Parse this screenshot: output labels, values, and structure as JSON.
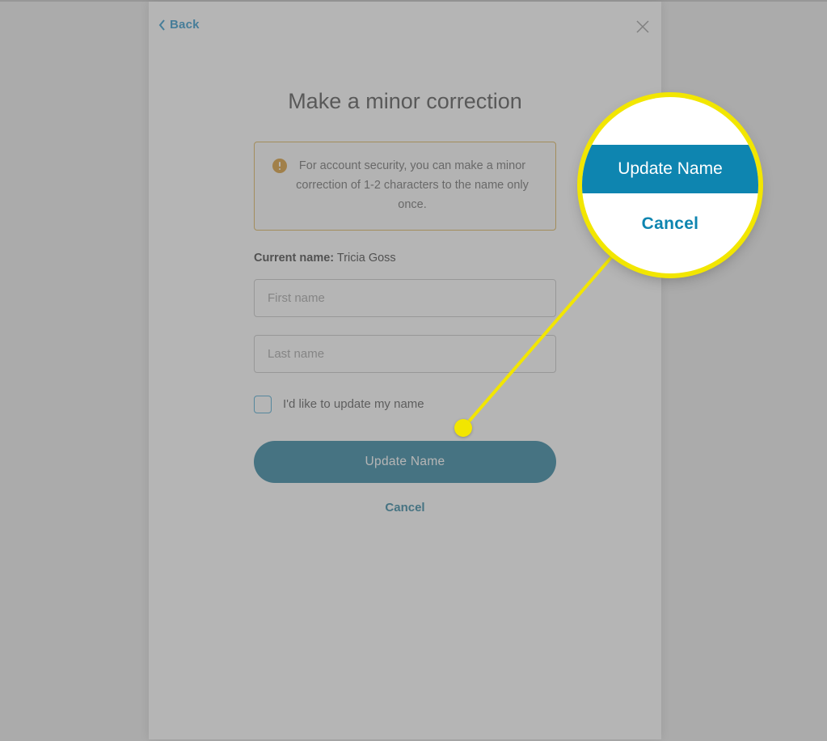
{
  "header": {
    "back_label": "Back"
  },
  "title": "Make a minor correction",
  "alert": {
    "text": "For account security, you can make a minor correction of 1-2 characters to the name only once."
  },
  "current_name": {
    "label": "Current name:",
    "value": "Tricia Goss"
  },
  "fields": {
    "first_placeholder": "First name",
    "last_placeholder": "Last name"
  },
  "checkbox": {
    "label": "I'd like to update my name"
  },
  "actions": {
    "update_label": "Update Name",
    "cancel_label": "Cancel"
  },
  "callout": {
    "button_label": "Update Name",
    "cancel_label": "Cancel"
  }
}
